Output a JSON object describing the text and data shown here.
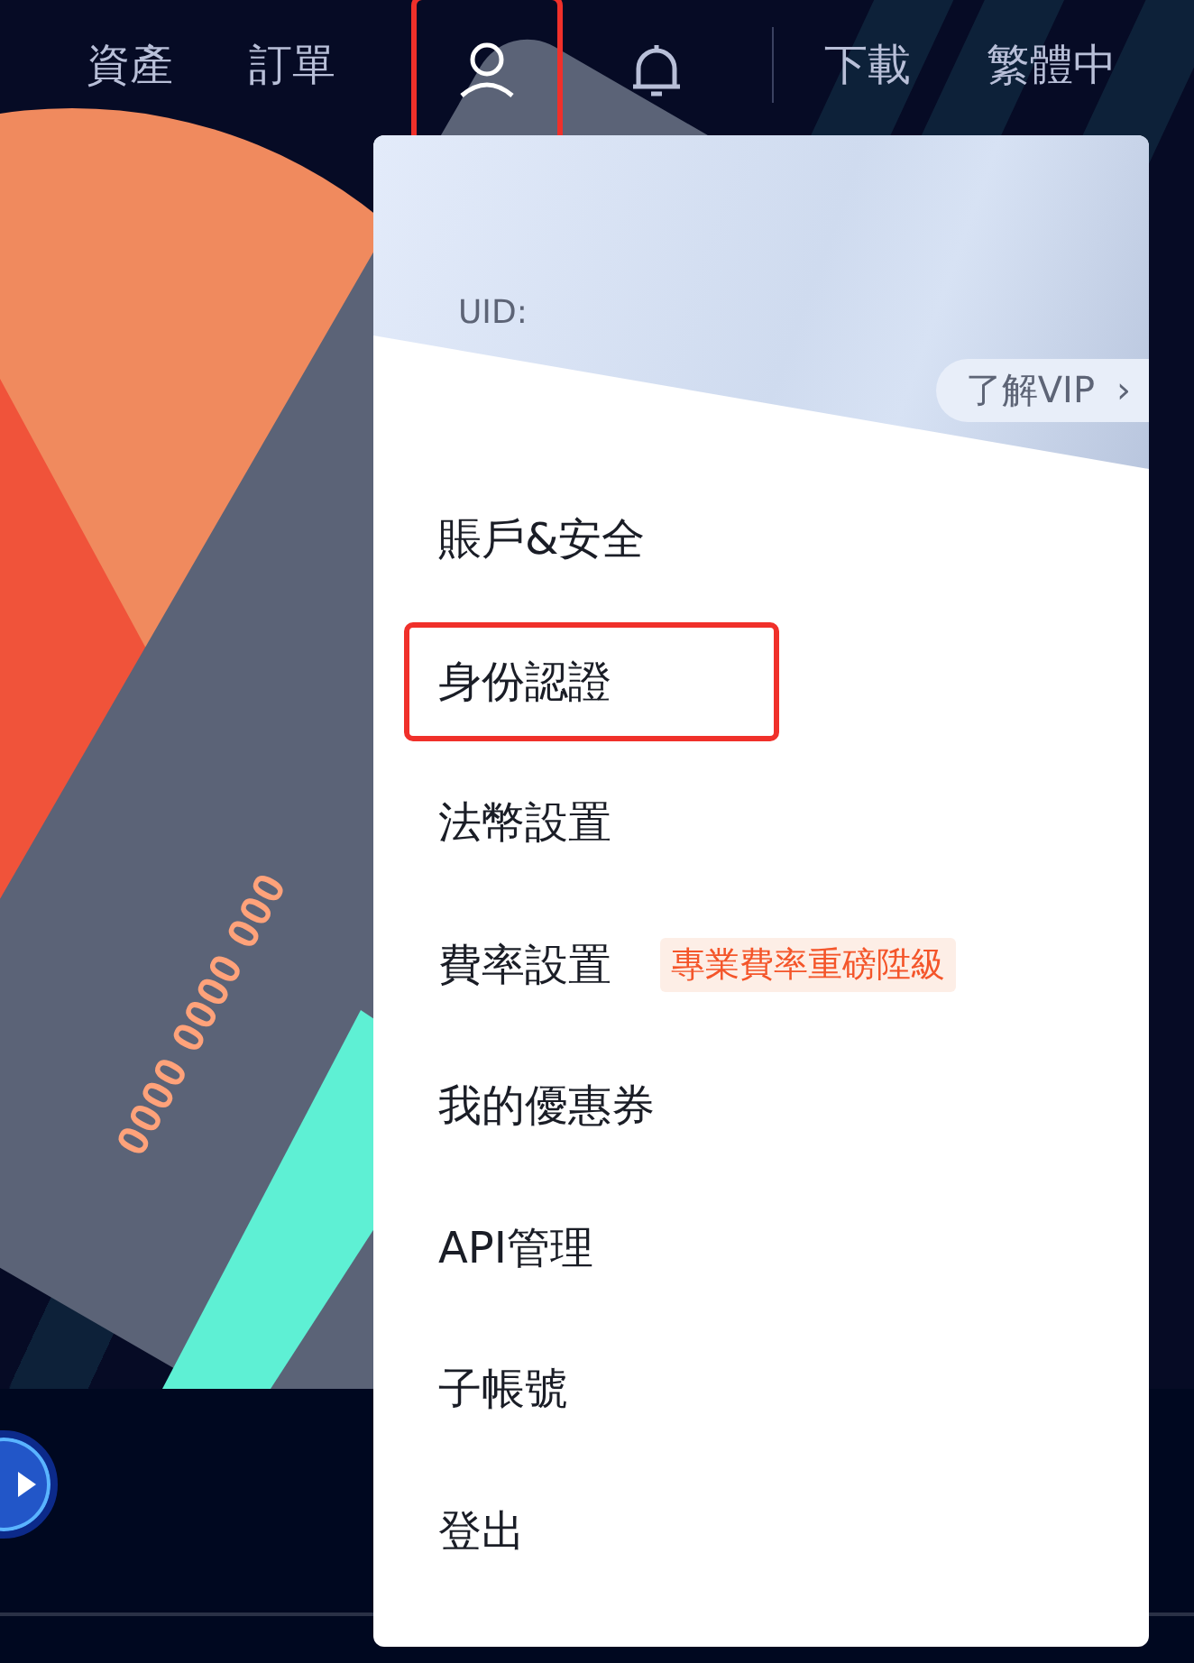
{
  "nav": {
    "items": [
      {
        "kind": "text",
        "label": "資產",
        "highlighted": false
      },
      {
        "kind": "text",
        "label": "訂單",
        "highlighted": false
      },
      {
        "kind": "user",
        "highlighted": true
      },
      {
        "kind": "bell",
        "highlighted": false
      },
      {
        "kind": "divider"
      },
      {
        "kind": "text",
        "label": "下載",
        "highlighted": false
      },
      {
        "kind": "text",
        "label": "繁體中",
        "highlighted": false
      }
    ]
  },
  "hero": {
    "card_number": "0000 0000 000"
  },
  "dropdown": {
    "uid_label": "UID:",
    "vip_link": "了解VIP",
    "vip_arrow": "›",
    "items": [
      {
        "label": "賬戶&安全",
        "highlighted": false
      },
      {
        "label": "身份認證",
        "highlighted": true
      },
      {
        "label": "法幣設置",
        "highlighted": false
      },
      {
        "label": "費率設置",
        "badge": "專業費率重磅陞級",
        "highlighted": false
      },
      {
        "label": "我的優惠券",
        "highlighted": false
      },
      {
        "label": "API管理",
        "highlighted": false
      },
      {
        "label": "子帳號",
        "highlighted": false
      },
      {
        "label": "登出",
        "highlighted": false
      }
    ]
  }
}
